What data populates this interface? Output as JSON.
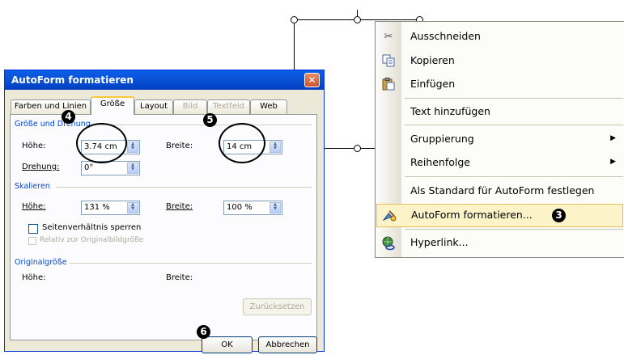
{
  "dialog": {
    "title": "AutoForm formatieren",
    "close_glyph": "✕",
    "tabs": [
      {
        "label": "Farben und Linien",
        "state": "normal"
      },
      {
        "label": "Größe",
        "state": "active"
      },
      {
        "label": "Layout",
        "state": "normal"
      },
      {
        "label": "Bild",
        "state": "disabled"
      },
      {
        "label": "Textfeld",
        "state": "disabled"
      },
      {
        "label": "Web",
        "state": "normal"
      }
    ],
    "sections": {
      "size_rotation": "Größe und Drehung",
      "scale": "Skalieren",
      "original": "Originalgröße"
    },
    "fields": {
      "hoehe_label": "Höhe:",
      "hoehe_value": "3.74 cm",
      "breite_label": "Breite:",
      "breite_value": "14 cm",
      "drehung_label": "Drehung:",
      "drehung_value": "0°",
      "scale_hoehe_label": "Höhe:",
      "scale_hoehe_value": "131 %",
      "scale_breite_label": "Breite:",
      "scale_breite_value": "100 %",
      "lock_ratio_label": "Seitenverhältnis sperren",
      "relative_label": "Relativ zur Originalbildgröße",
      "orig_hoehe_label": "Höhe:",
      "orig_breite_label": "Breite:"
    },
    "buttons": {
      "reset": "Zurücksetzen",
      "ok": "OK",
      "cancel": "Abbrechen"
    }
  },
  "context_menu": {
    "items": [
      {
        "label": "Ausschneiden",
        "icon": "scissors-icon"
      },
      {
        "label": "Kopieren",
        "icon": "copy-icon"
      },
      {
        "label": "Einfügen",
        "icon": "paste-icon"
      },
      {
        "label": "Text hinzufügen",
        "icon": ""
      },
      {
        "label": "Gruppierung",
        "icon": "",
        "submenu": "▶"
      },
      {
        "label": "Reihenfolge",
        "icon": "",
        "submenu": "▶"
      },
      {
        "label": "Als Standard für AutoForm festlegen",
        "icon": ""
      },
      {
        "label": "AutoForm formatieren...",
        "icon": "format-shape-icon",
        "highlighted": true
      },
      {
        "label": "Hyperlink...",
        "icon": "hyperlink-icon"
      }
    ]
  },
  "callouts": {
    "n3": "3",
    "n4": "4",
    "n5": "5",
    "n6": "6"
  },
  "colors": {
    "titlebar": "#0a53d8",
    "menu_highlight": "#fcf3c9",
    "section_label": "#0046d5"
  }
}
